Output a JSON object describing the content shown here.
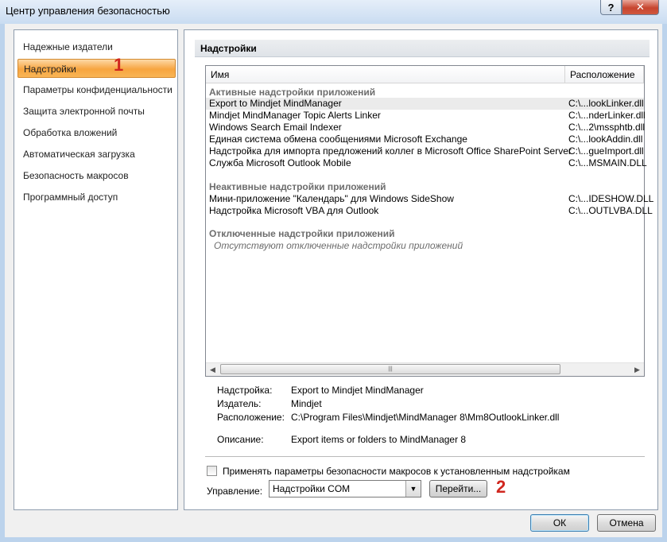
{
  "window": {
    "title": "Центр управления безопасностью",
    "help_label": "?",
    "close_label": "✕"
  },
  "sidebar": {
    "items": [
      {
        "label": "Надежные издатели"
      },
      {
        "label": "Надстройки"
      },
      {
        "label": "Параметры конфиденциальности"
      },
      {
        "label": "Защита электронной почты"
      },
      {
        "label": "Обработка вложений"
      },
      {
        "label": "Автоматическая загрузка"
      },
      {
        "label": "Безопасность макросов"
      },
      {
        "label": "Программный доступ"
      }
    ],
    "marker": "1"
  },
  "main": {
    "section_title": "Надстройки",
    "columns": {
      "name": "Имя",
      "location": "Расположение"
    },
    "groups": {
      "active": {
        "title": "Активные надстройки приложений",
        "rows": [
          {
            "name": "Export to Mindjet MindManager",
            "location": "C:\\...lookLinker.dll"
          },
          {
            "name": "Mindjet MindManager Topic Alerts Linker",
            "location": "C:\\...nderLinker.dll"
          },
          {
            "name": "Windows Search Email Indexer",
            "location": "C:\\...2\\mssphtb.dll"
          },
          {
            "name": "Единая система обмена сообщениями Microsoft Exchange",
            "location": "C:\\...lookAddin.dll"
          },
          {
            "name": "Надстройка для импорта предложений коллег в Microsoft Office SharePoint Server",
            "location": "C:\\...gueImport.dll"
          },
          {
            "name": "Служба Microsoft Outlook Mobile",
            "location": "C:\\...MSMAIN.DLL"
          }
        ]
      },
      "inactive": {
        "title": "Неактивные надстройки приложений",
        "rows": [
          {
            "name": "Мини-приложение \"Календарь\" для Windows SideShow",
            "location": "C:\\...IDESHOW.DLL"
          },
          {
            "name": "Надстройка Microsoft VBA для Outlook",
            "location": "C:\\...OUTLVBA.DLL"
          }
        ]
      },
      "disabled": {
        "title": "Отключенные надстройки приложений",
        "note": "Отсутствуют отключенные надстройки приложений"
      }
    },
    "details": {
      "addin_label": "Надстройка:",
      "addin_value": "Export to Mindjet MindManager",
      "publisher_label": "Издатель:",
      "publisher_value": "Mindjet",
      "location_label": "Расположение:",
      "location_value": "C:\\Program Files\\Mindjet\\MindManager 8\\Mm8OutlookLinker.dll",
      "description_label": "Описание:",
      "description_value": "Export items or folders to MindManager 8"
    },
    "checkbox_label": "Применять параметры безопасности макросов к установленным надстройкам",
    "checkbox_checked": false,
    "manage_label": "Управление:",
    "manage_select_value": "Надстройки COM",
    "goto_label": "Перейти...",
    "marker": "2"
  },
  "footer": {
    "ok_label": "ОК",
    "cancel_label": "Отмена"
  },
  "colors": {
    "selected_gradient_mid": "#f7a540",
    "marker": "#d0271f",
    "window_frame": "#bcd3ec"
  }
}
